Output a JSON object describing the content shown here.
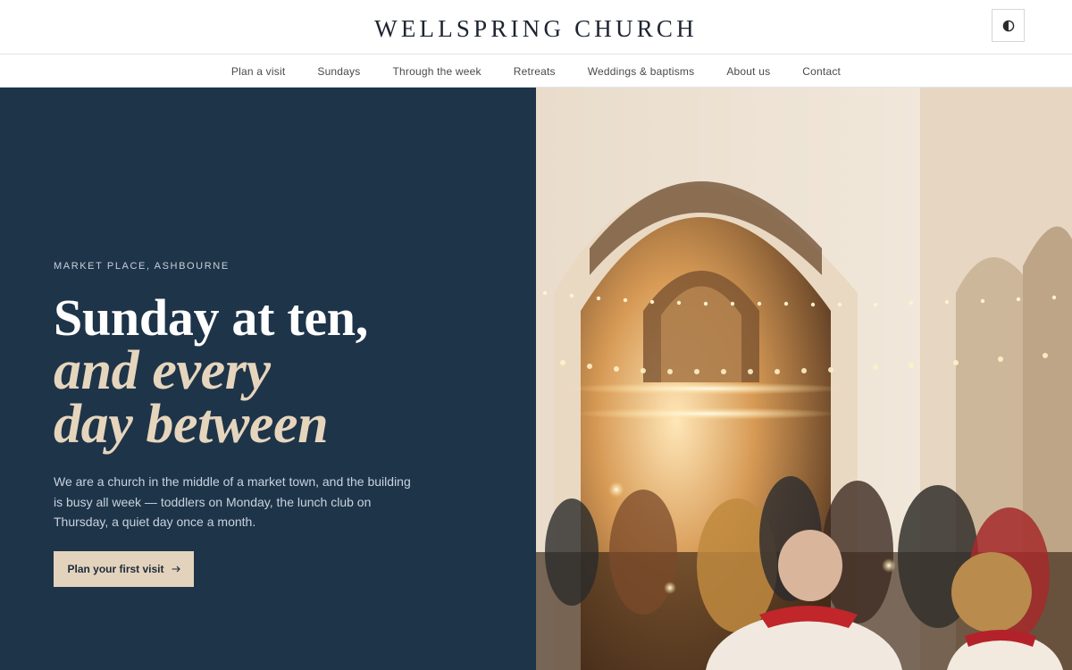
{
  "header": {
    "brand": "WELLSPRING CHURCH",
    "theme_toggle_icon": "contrast-icon"
  },
  "nav": {
    "items": [
      {
        "label": "Plan a visit"
      },
      {
        "label": "Sundays"
      },
      {
        "label": "Through the week"
      },
      {
        "label": "Retreats"
      },
      {
        "label": "Weddings & baptisms"
      },
      {
        "label": "About us"
      },
      {
        "label": "Contact"
      }
    ]
  },
  "hero": {
    "eyebrow": "MARKET PLACE, ASHBOURNE",
    "headline": {
      "line1": "Sunday at ten,",
      "line2": "and every",
      "line3": "day between"
    },
    "lede": "We are a church in the middle of a market town, and the building is busy all week — toddlers on Monday, the lunch club on Thursday, a quiet day once a month.",
    "cta_label": "Plan your first visit",
    "cta_icon": "arrow-right-icon",
    "image_subject": "church-interior-photo"
  },
  "colors": {
    "hero_panel": "#1e3449",
    "accent_cream": "#e3d3bd",
    "headline_italic": "#e6d5bd"
  }
}
